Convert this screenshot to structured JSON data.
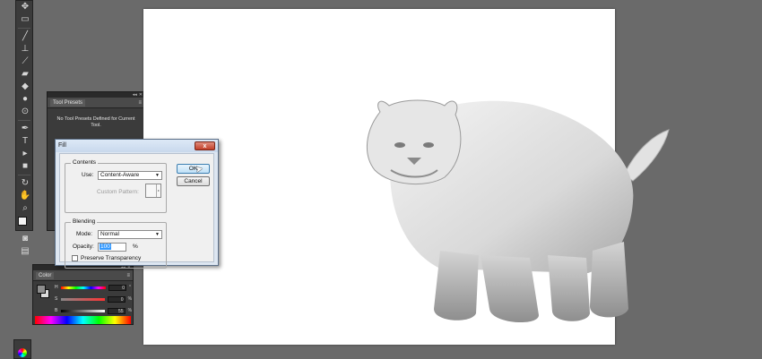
{
  "tools_bar": {
    "icons": [
      "move-icon",
      "marquee-icon",
      "brush-icon",
      "stamp-icon",
      "history-brush-icon",
      "eraser-icon",
      "bucket-icon",
      "blur-icon",
      "dodge-icon",
      "pen-icon",
      "type-icon",
      "path-select-icon",
      "shape-icon",
      "3d-rotate-icon",
      "hand-icon",
      "zoom-icon"
    ]
  },
  "tool_presets_panel": {
    "tab_label": "Tool Presets",
    "message": "No Tool Presets Defined for Current Tool."
  },
  "color_panel": {
    "tab_label": "Color",
    "sliders": [
      {
        "letter": "H",
        "value": "0",
        "unit": "°"
      },
      {
        "letter": "S",
        "value": "0",
        "unit": "%"
      },
      {
        "letter": "B",
        "value": "55",
        "unit": "%"
      }
    ],
    "foreground_color": "#8d8d8d",
    "background_color": "#dcdcdc"
  },
  "fill_dialog": {
    "title": "Fill",
    "close_label": "x",
    "contents": {
      "group_label": "Contents",
      "use_label": "Use:",
      "use_value": "Content-Aware",
      "custom_pattern_label": "Custom Pattern:"
    },
    "blending": {
      "group_label": "Blending",
      "mode_label": "Mode:",
      "mode_value": "Normal",
      "opacity_label": "Opacity:",
      "opacity_value": "100",
      "opacity_unit": "%",
      "preserve_label": "Preserve Transparency"
    },
    "ok_label": "OK",
    "cancel_label": "Cancel"
  }
}
